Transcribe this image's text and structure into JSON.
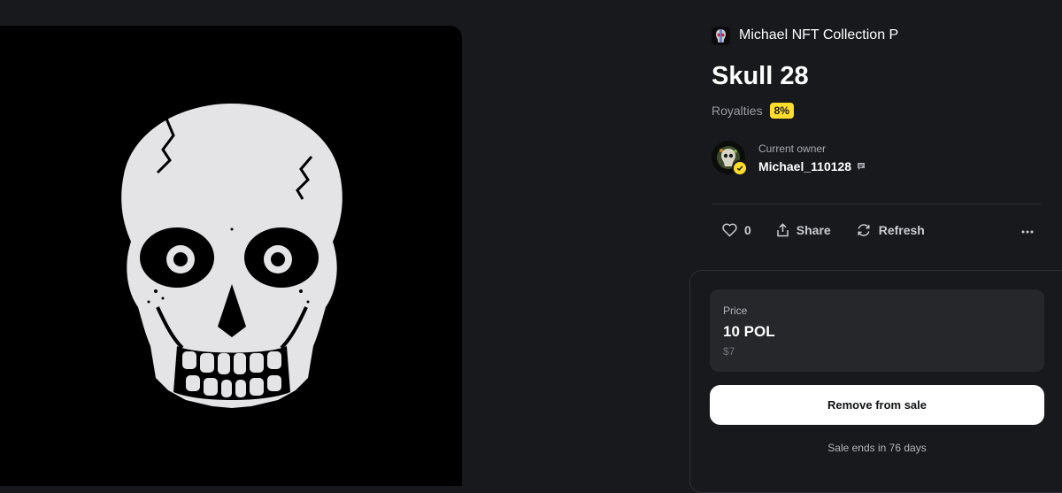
{
  "collection": {
    "name": "Michael NFT Collection P",
    "avatar_icon": "skull-avatar-icon"
  },
  "nft": {
    "title": "Skull 28",
    "image_icon": "skull-artwork"
  },
  "royalties": {
    "label": "Royalties",
    "value": "8%"
  },
  "owner": {
    "label": "Current owner",
    "name": "Michael_110128",
    "verified": true
  },
  "actions": {
    "likes_count": "0",
    "share_label": "Share",
    "refresh_label": "Refresh"
  },
  "sale": {
    "price_label": "Price",
    "price_value": "10 POL",
    "price_fiat": "$7",
    "remove_button_label": "Remove from sale",
    "ends_text": "Sale ends in 76 days"
  },
  "colors": {
    "background": "#18191c",
    "accent_yellow": "#fedd2c",
    "card_surface": "#26272b",
    "border": "#2c2e33"
  }
}
